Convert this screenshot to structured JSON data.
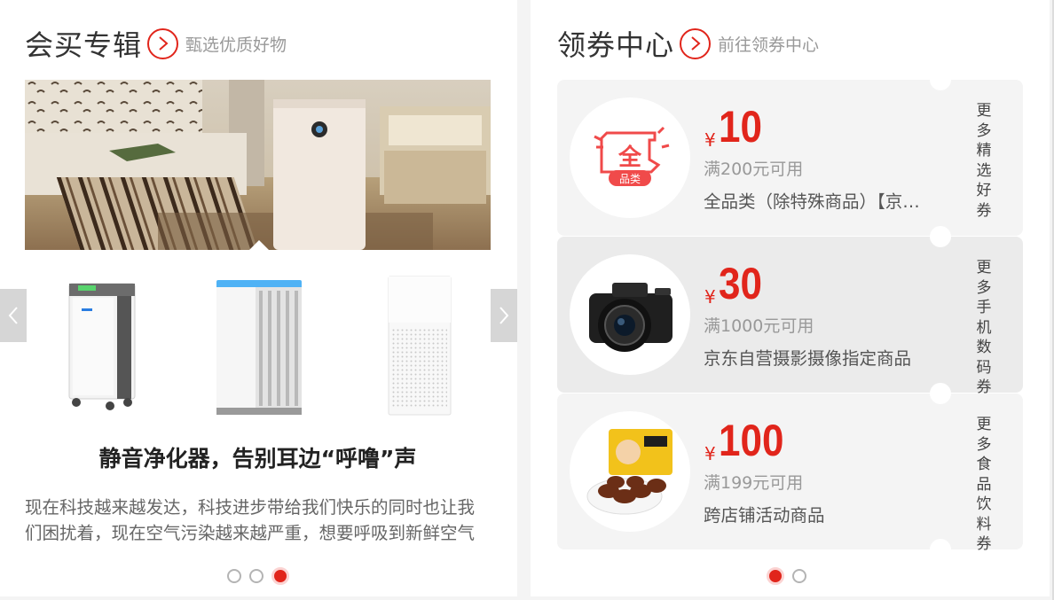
{
  "left": {
    "title": "会买专辑",
    "subtitle": "甄选优质好物",
    "card_title": "静音净化器，告别耳边“呼噜”声",
    "card_desc": "现在科技越来越发达，科技进步带给我们快乐的同时也让我们困扰着，现在空气污染越来越严重，想要呼吸到新鲜空气也越来越难了。",
    "dots": [
      false,
      false,
      true
    ]
  },
  "right": {
    "title": "领券中心",
    "subtitle": "前往领券中心",
    "coupons": [
      {
        "yen": "¥",
        "amount": "10",
        "condition": "满200元可用",
        "scope": "全品类（除特殊商品）【京东超市】",
        "more": "更多精选好券",
        "image": "all-category-badge",
        "badge_text": "全",
        "badge_sub": "品类"
      },
      {
        "yen": "¥",
        "amount": "30",
        "condition": "满1000元可用",
        "scope": "京东自营摄影摄像指定商品",
        "more": "更多手机数码券",
        "image": "camera"
      },
      {
        "yen": "¥",
        "amount": "100",
        "condition": "满199元可用",
        "scope": "跨店铺活动商品",
        "more": "更多食品饮料券",
        "image": "braised-snack"
      }
    ],
    "dots": [
      true,
      false
    ]
  },
  "colors": {
    "accent": "#e1251b",
    "text": "#333333",
    "muted": "#999999"
  }
}
